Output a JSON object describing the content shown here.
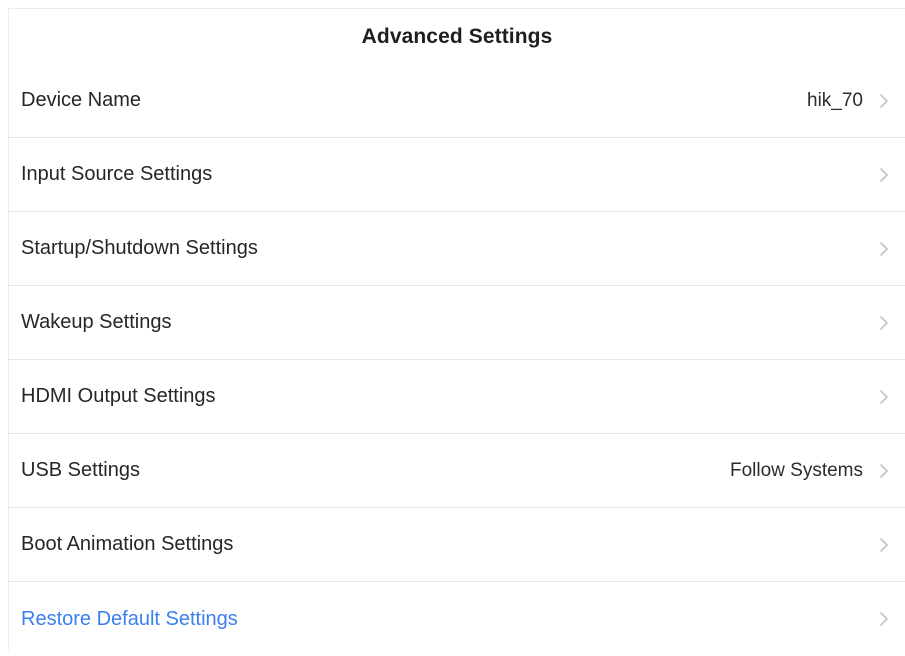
{
  "header": {
    "title": "Advanced Settings"
  },
  "items": [
    {
      "label": "Device Name",
      "value": "hik_70",
      "accent": false
    },
    {
      "label": "Input Source Settings",
      "value": "",
      "accent": false
    },
    {
      "label": "Startup/Shutdown Settings",
      "value": "",
      "accent": false
    },
    {
      "label": "Wakeup Settings",
      "value": "",
      "accent": false
    },
    {
      "label": "HDMI Output Settings",
      "value": "",
      "accent": false
    },
    {
      "label": "USB Settings",
      "value": "Follow Systems",
      "accent": false
    },
    {
      "label": "Boot Animation Settings",
      "value": "",
      "accent": false
    },
    {
      "label": "Restore Default Settings",
      "value": "",
      "accent": true
    }
  ],
  "icons": {
    "row_chevron": "chevron-right-icon"
  },
  "colors": {
    "accent": "#3b7ff0",
    "text": "#262626",
    "divider": "#e6e6e6",
    "chevron": "#c4c4c4"
  }
}
